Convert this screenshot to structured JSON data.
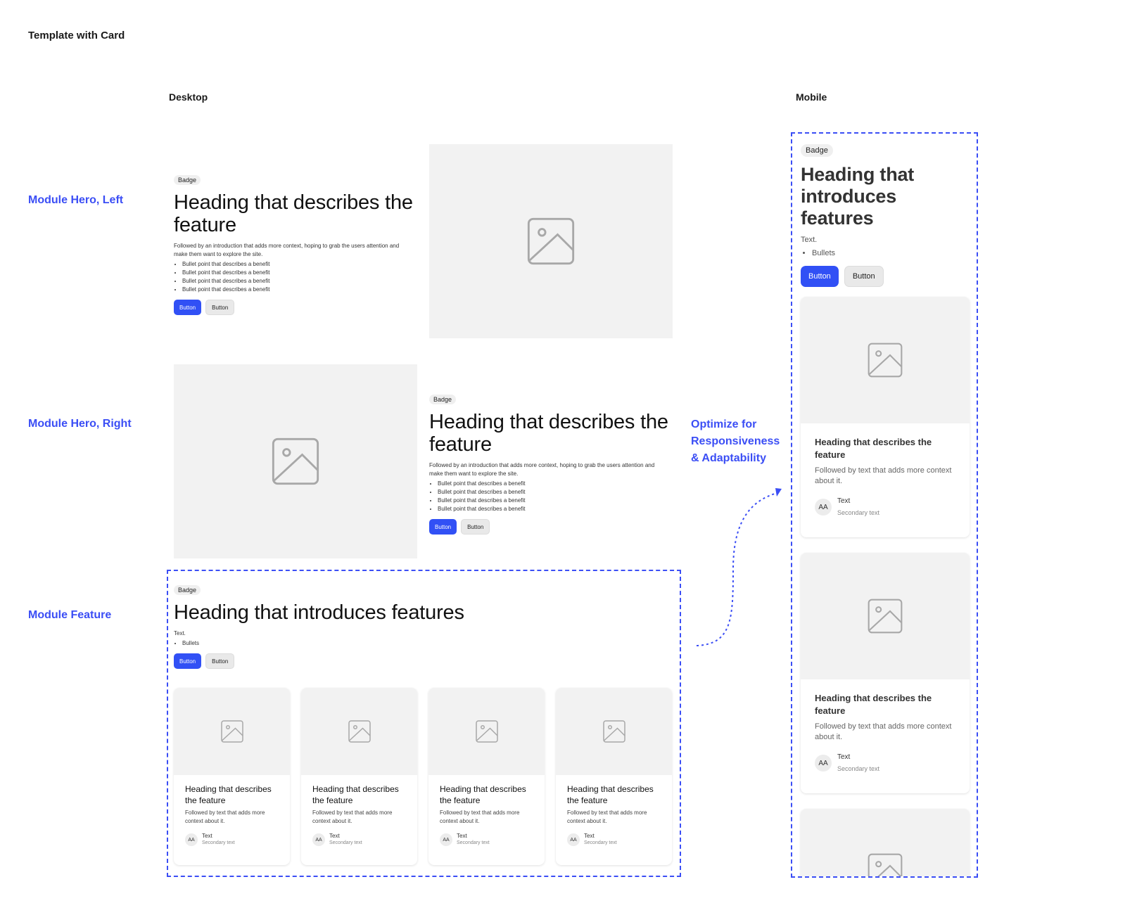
{
  "page_title": "Template with Card",
  "columns": {
    "desktop": "Desktop",
    "mobile": "Mobile"
  },
  "row_labels": {
    "hero_left": "Module Hero, Left",
    "hero_right": "Module Hero, Right",
    "feature": "Module Feature"
  },
  "annotation": {
    "line1": "Optimize for",
    "line2": "Responsiveness",
    "line3": "& Adaptability"
  },
  "accent_color": "#3b4ef5",
  "primary_button_color": "#3150f5",
  "hero_left": {
    "badge": "Badge",
    "heading": "Heading that describes the feature",
    "intro": "Followed by an introduction that adds more context, hoping to grab the users attention and make them want to explore the site.",
    "bullets": [
      "Bullet point that describes a benefit",
      "Bullet point that describes a benefit",
      "Bullet point that describes a benefit",
      "Bullet point that describes a benefit"
    ],
    "primary_button": "Button",
    "secondary_button": "Button",
    "image_icon": "image-icon"
  },
  "hero_right": {
    "badge": "Badge",
    "heading": "Heading that describes the feature",
    "intro": "Followed by an introduction that adds more context, hoping to grab the users attention and make them want to explore the site.",
    "bullets": [
      "Bullet point that describes a benefit",
      "Bullet point that describes a benefit",
      "Bullet point that describes a benefit",
      "Bullet point that describes a benefit"
    ],
    "primary_button": "Button",
    "secondary_button": "Button",
    "image_icon": "image-icon"
  },
  "feature": {
    "badge": "Badge",
    "heading": "Heading that introduces features",
    "text": "Text.",
    "bullets": [
      "Bullets"
    ],
    "primary_button": "Button",
    "secondary_button": "Button",
    "cards": [
      {
        "heading": "Heading that describes the feature",
        "body": "Followed by text that adds more context about it.",
        "avatar": "AA",
        "meta_text": "Text",
        "meta_secondary": "Secondary text"
      },
      {
        "heading": "Heading that describes the feature",
        "body": "Followed by text that adds more context about it.",
        "avatar": "AA",
        "meta_text": "Text",
        "meta_secondary": "Secondary text"
      },
      {
        "heading": "Heading that describes the feature",
        "body": "Followed by text that adds more context about it.",
        "avatar": "AA",
        "meta_text": "Text",
        "meta_secondary": "Secondary text"
      },
      {
        "heading": "Heading that describes the feature",
        "body": "Followed by text that adds more context about it.",
        "avatar": "AA",
        "meta_text": "Text",
        "meta_secondary": "Secondary text"
      }
    ]
  },
  "mobile": {
    "badge": "Badge",
    "heading": "Heading that introduces features",
    "text": "Text.",
    "bullets": [
      "Bullets"
    ],
    "primary_button": "Button",
    "secondary_button": "Button",
    "cards": [
      {
        "heading": "Heading that describes the feature",
        "body": "Followed by text that adds more context about it.",
        "avatar": "AA",
        "meta_text": "Text",
        "meta_secondary": "Secondary text"
      },
      {
        "heading": "Heading that describes the feature",
        "body": "Followed by text that adds more context about it.",
        "avatar": "AA",
        "meta_text": "Text",
        "meta_secondary": "Secondary text"
      }
    ]
  }
}
